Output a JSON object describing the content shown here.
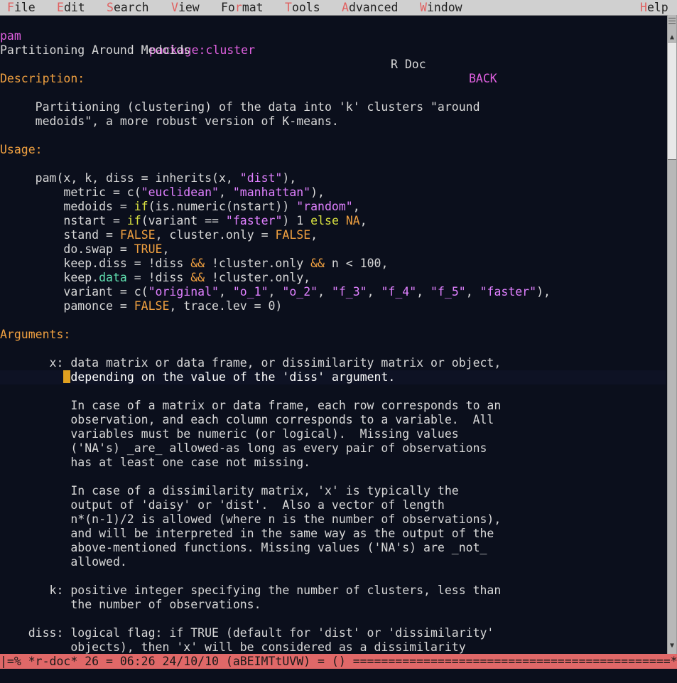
{
  "menu": {
    "items": [
      {
        "label": "File",
        "accel": "F",
        "rest": "ile"
      },
      {
        "label": "Edit",
        "accel": "E",
        "rest": "dit"
      },
      {
        "label": "Search",
        "accel": "S",
        "rest": "earch"
      },
      {
        "label": "View",
        "accel": "V",
        "rest": "iew"
      },
      {
        "label": "Format",
        "pre": "Fo",
        "accel": "r",
        "rest": "mat"
      },
      {
        "label": "Tools",
        "accel": "T",
        "rest": "ools"
      },
      {
        "label": "Advanced",
        "accel": "A",
        "rest": "dvanced"
      },
      {
        "label": "Window",
        "accel": "W",
        "rest": "indow"
      },
      {
        "label": "Help",
        "accel": "H",
        "rest": "elp"
      }
    ]
  },
  "header": {
    "topic": "pam",
    "package": "package:cluster",
    "doc": "R Doc",
    "back": "BACK"
  },
  "doc": {
    "title": "Partitioning Around Medoids",
    "description_heading": "Description:",
    "description_1": "     Partitioning (clustering) of the data into 'k' clusters \"around",
    "description_2": "     medoids\", a more robust version of K-means.",
    "usage_heading": "Usage:",
    "usage": [
      "     pam(x, k, diss = inherits(x, \"dist\"),",
      "         metric = c(\"euclidean\", \"manhattan\"),",
      "         medoids = if(is.numeric(nstart)) \"random\",",
      "         nstart = if(variant == \"faster\") 1 else NA,",
      "         stand = FALSE, cluster.only = FALSE,",
      "         do.swap = TRUE,",
      "         keep.diss = !diss && !cluster.only && n < 100,",
      "         keep.data = !diss && !cluster.only,",
      "         variant = c(\"original\", \"o_1\", \"o_2\", \"f_3\", \"f_4\", \"f_5\", \"faster\"),",
      "         pamonce = FALSE, trace.lev = 0)"
    ],
    "arguments_heading": "Arguments:",
    "arg_x_1": "       x: data matrix or data frame, or dissimilarity matrix or object,",
    "arg_x_2_prefix": "         ",
    "arg_x_2": "depending on the value of the 'diss' argument.",
    "arg_x_p1": [
      "          In case of a matrix or data frame, each row corresponds to an",
      "          observation, and each column corresponds to a variable.  All",
      "          variables must be numeric (or logical).  Missing values",
      "          ('NA's) _are_ allowed-as long as every pair of observations",
      "          has at least one case not missing."
    ],
    "arg_x_p2": [
      "          In case of a dissimilarity matrix, 'x' is typically the",
      "          output of 'daisy' or 'dist'.  Also a vector of length",
      "          n*(n-1)/2 is allowed (where n is the number of observations),",
      "          and will be interpreted in the same way as the output of the",
      "          above-mentioned functions. Missing values ('NA's) are _not_",
      "          allowed."
    ],
    "arg_k": [
      "       k: positive integer specifying the number of clusters, less than",
      "          the number of observations."
    ],
    "arg_diss": [
      "    diss: logical flag: if TRUE (default for 'dist' or 'dissimilarity'",
      "          objects), then 'x' will be considered as a dissimilarity"
    ]
  },
  "modeline": {
    "text": "|=% *r-doc* 26 = 06:26 24/10/10 (aBEIMTtUVW) = () =============================================*"
  },
  "colors": {
    "background": "#0b0f1c",
    "heading": "#f0a040",
    "string": "#e080ff",
    "modeline": "#e06868"
  }
}
